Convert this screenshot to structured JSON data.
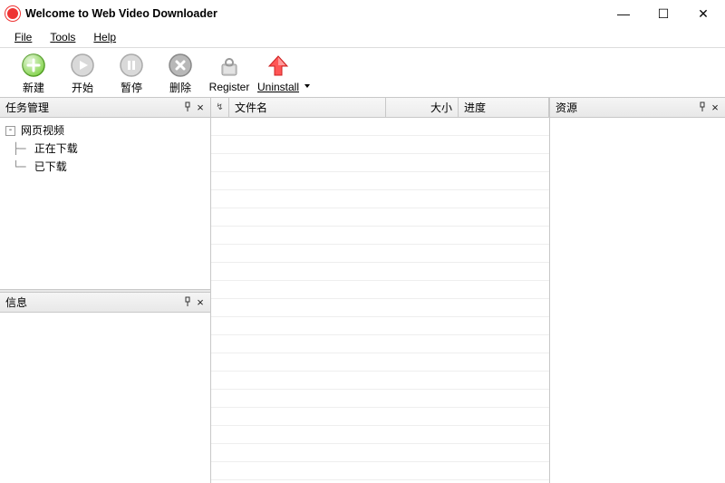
{
  "window": {
    "title": "Welcome to Web Video Downloader"
  },
  "menu": {
    "file": "File",
    "tools": "Tools",
    "help": "Help"
  },
  "toolbar": {
    "new": "新建",
    "start": "开始",
    "pause": "暂停",
    "delete": "删除",
    "register": "Register",
    "uninstall": "Uninstall"
  },
  "panes": {
    "tasks": {
      "title": "任务管理"
    },
    "info": {
      "title": "信息"
    },
    "resources": {
      "title": "资源"
    }
  },
  "tree": {
    "root": "网页视频",
    "downloading": "正在下载",
    "downloaded": "已下载"
  },
  "columns": {
    "filename": "文件名",
    "size": "大小",
    "progress": "进度"
  }
}
